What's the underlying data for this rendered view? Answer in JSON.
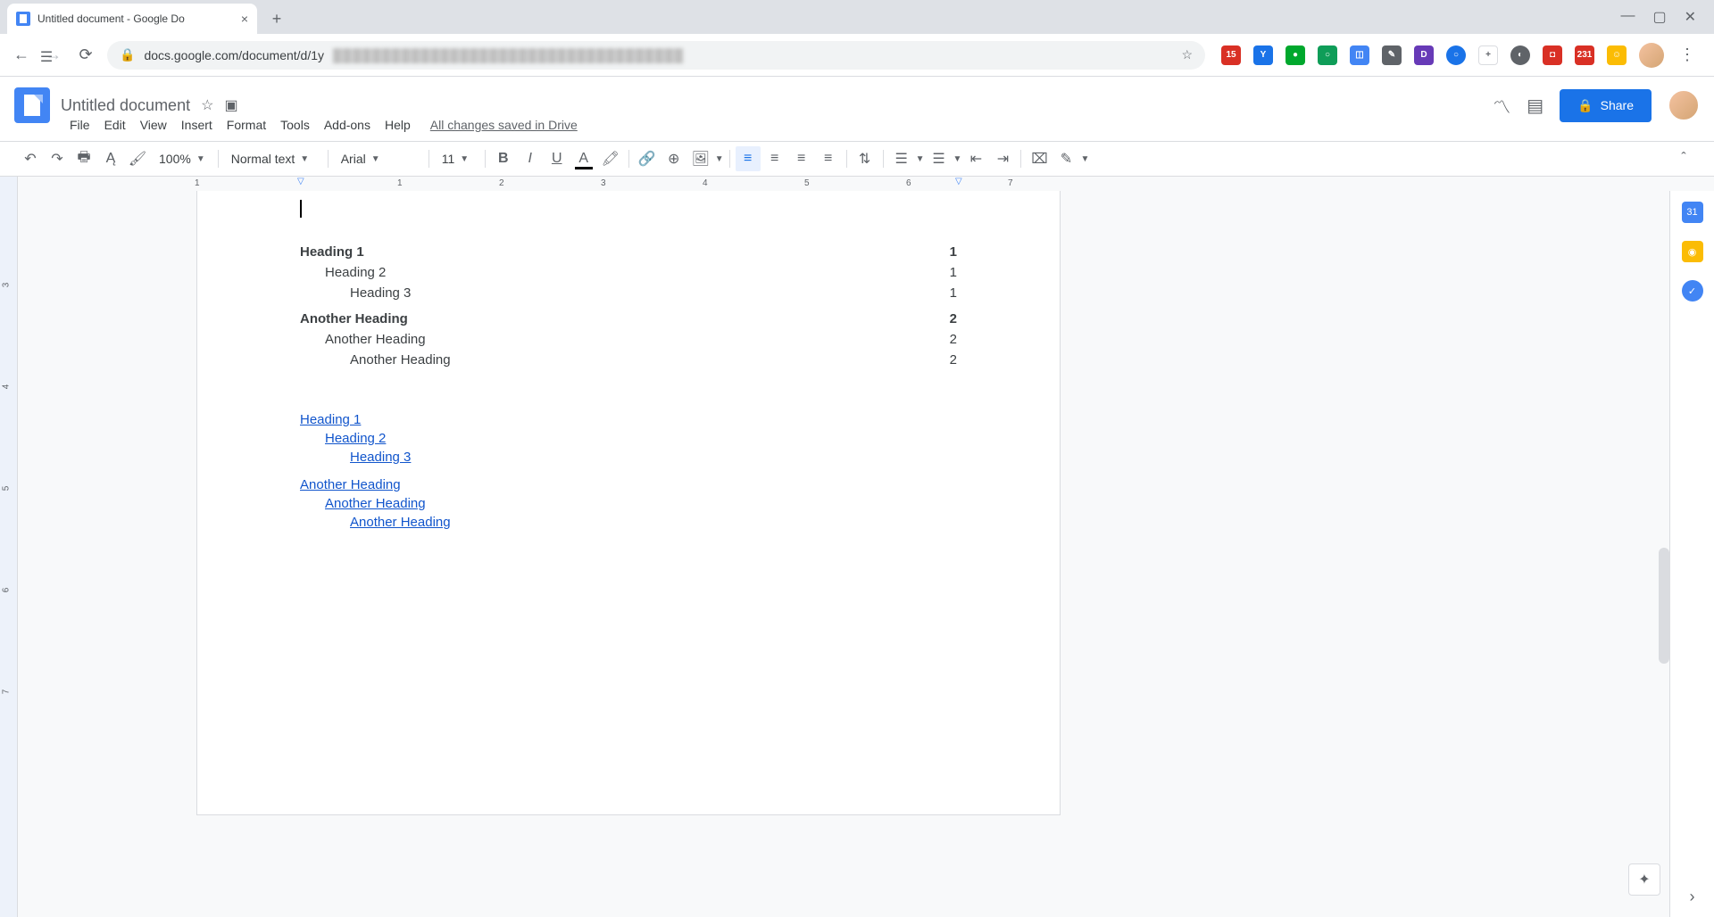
{
  "browser": {
    "tab_title": "Untitled document - Google Do",
    "url_prefix": "docs.google.com/document/d/1y"
  },
  "header": {
    "doc_title": "Untitled document",
    "share_label": "Share",
    "saved_status": "All changes saved in Drive"
  },
  "menu": {
    "file": "File",
    "edit": "Edit",
    "view": "View",
    "insert": "Insert",
    "format": "Format",
    "tools": "Tools",
    "addons": "Add-ons",
    "help": "Help"
  },
  "toolbar": {
    "zoom": "100%",
    "style": "Normal text",
    "font": "Arial",
    "size": "11"
  },
  "ruler": {
    "marks": [
      "1",
      "1",
      "2",
      "3",
      "4",
      "5",
      "6",
      "7"
    ],
    "vmarks": [
      "3",
      "4",
      "5",
      "6",
      "7"
    ]
  },
  "toc_plain": [
    {
      "label": "Heading 1",
      "page": "1",
      "level": 1,
      "bold": true
    },
    {
      "label": "Heading 2",
      "page": "1",
      "level": 2,
      "bold": false
    },
    {
      "label": "Heading 3",
      "page": "1",
      "level": 3,
      "bold": false
    },
    {
      "label": "Another Heading",
      "page": "2",
      "level": 1,
      "bold": true,
      "spacer": true
    },
    {
      "label": "Another Heading",
      "page": "2",
      "level": 2,
      "bold": false
    },
    {
      "label": "Another Heading",
      "page": "2",
      "level": 3,
      "bold": false
    }
  ],
  "toc_links": [
    {
      "label": "Heading 1",
      "level": 1
    },
    {
      "label": "Heading 2",
      "level": 2
    },
    {
      "label": "Heading 3",
      "level": 3
    },
    {
      "label": "Another Heading",
      "level": 1,
      "spacer": true
    },
    {
      "label": "Another Heading",
      "level": 2
    },
    {
      "label": "Another Heading",
      "level": 3
    }
  ],
  "extensions": {
    "cal_day": "15",
    "abp_day": "231"
  }
}
